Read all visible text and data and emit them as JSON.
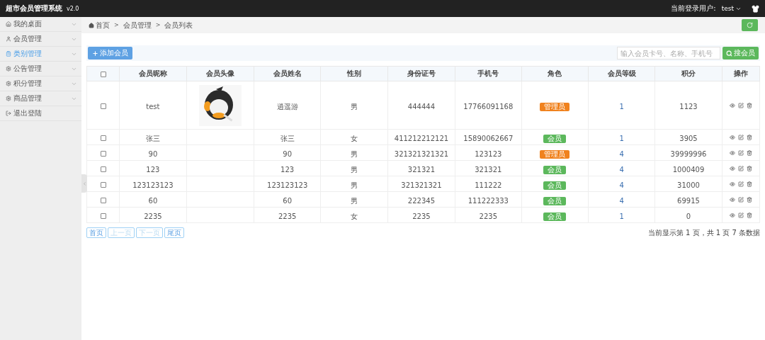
{
  "header": {
    "title": "超市会员管理系统",
    "version": "v2.0",
    "user_label": "当前登录用户:",
    "user_name": "test"
  },
  "sidebar": {
    "items": [
      {
        "label": "我的桌面",
        "selected": false,
        "kind": "menu"
      },
      {
        "label": "会员管理",
        "selected": false,
        "kind": "menu"
      },
      {
        "label": "类别管理",
        "selected": true,
        "kind": "menu"
      },
      {
        "label": "公告管理",
        "selected": false,
        "kind": "menu"
      },
      {
        "label": "积分管理",
        "selected": false,
        "kind": "menu"
      },
      {
        "label": "商品管理",
        "selected": false,
        "kind": "menu"
      },
      {
        "label": "退出登陆",
        "selected": false,
        "kind": "link"
      }
    ]
  },
  "breadcrumb": {
    "items": [
      "首页",
      "会员管理",
      "会员列表"
    ],
    "separator": ">"
  },
  "toolbar": {
    "add_button": "添加会员",
    "search": {
      "placeholder": "输入会员卡号、名称、手机号"
    },
    "search_button": "搜会员"
  },
  "table": {
    "select_all": {
      "checked": false
    },
    "columns": [
      "会员昵称",
      "会员头像",
      "会员姓名",
      "性别",
      "身份证号",
      "手机号",
      "角色",
      "会员等级",
      "积分",
      "操作"
    ],
    "rows": [
      {
        "checked": false,
        "nickname": "test",
        "name": "逍遥游",
        "gender": "男",
        "id_number": "444444",
        "phone": "17766091168",
        "role": {
          "label": "管理员",
          "kind": "admin"
        },
        "level": "1",
        "points": "1123"
      },
      {
        "checked": false,
        "nickname": "张三",
        "name": "张三",
        "gender": "女",
        "id_number": "411212212121",
        "phone": "15890062667",
        "role": {
          "label": "会员",
          "kind": "member"
        },
        "level": "1",
        "points": "3905"
      },
      {
        "checked": false,
        "nickname": "90",
        "name": "90",
        "gender": "男",
        "id_number": "321321321321",
        "phone": "123123",
        "role": {
          "label": "管理员",
          "kind": "admin"
        },
        "level": "4",
        "points": "39999996"
      },
      {
        "checked": false,
        "nickname": "123",
        "name": "123",
        "gender": "男",
        "id_number": "321321",
        "phone": "321321",
        "role": {
          "label": "会员",
          "kind": "member"
        },
        "level": "4",
        "points": "1000409"
      },
      {
        "checked": false,
        "nickname": "123123123",
        "name": "123123123",
        "gender": "男",
        "id_number": "321321321",
        "phone": "111222",
        "role": {
          "label": "会员",
          "kind": "member"
        },
        "level": "4",
        "points": "31000"
      },
      {
        "checked": false,
        "nickname": "60",
        "name": "60",
        "gender": "男",
        "id_number": "222345",
        "phone": "111222333",
        "role": {
          "label": "会员",
          "kind": "member"
        },
        "level": "4",
        "points": "69915"
      },
      {
        "checked": false,
        "nickname": "2235",
        "name": "2235",
        "gender": "女",
        "id_number": "2235",
        "phone": "2235",
        "role": {
          "label": "会员",
          "kind": "member"
        },
        "level": "1",
        "points": "0"
      }
    ]
  },
  "pagination": [
    {
      "label": "首页",
      "disabled": false
    },
    {
      "label": "上一页",
      "disabled": true
    },
    {
      "label": "下一页",
      "disabled": true
    },
    {
      "label": "尾页",
      "disabled": false
    }
  ],
  "page_info": "当前显示第 1 页，共 1 页 7 条数据"
}
